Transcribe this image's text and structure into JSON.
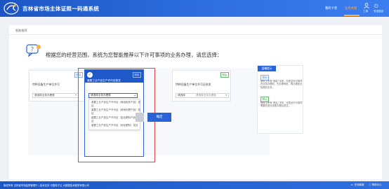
{
  "header": {
    "site_title": "吉林省市场主体证照一码通系统",
    "nav_mine": "我的卡卷",
    "nav_active": "业务办理",
    "user_label": "工商",
    "logout_label": "安全退出"
  },
  "breadcrumb": "智能推荐",
  "question": "根据您的经营范围，系统为您智能推荐以下许可事项的业务办理，请您选择：",
  "cards": [
    {
      "badge": "照后",
      "title": "特种设备生产单位许可",
      "select_value": "请选择业务办理类"
    },
    {
      "badge": "照前",
      "title": "重要工业产品生产许可证核发",
      "select_value": "请选择业务办理类",
      "dropdown": [
        "重要工业产品生产许可证（食品相关产品）发证",
        "重要工业产品生产许可证（其他化肥产品）发证",
        "重要工业产品生产许可证（复合肥料产品）发证",
        "重要工业产品生产许可证（危化肥料）发证"
      ]
    },
    {
      "badge": "照后",
      "title": "特种设备生产单位许可证核发",
      "select_value": "请选择",
      "hint": "请选择业务办理类"
    }
  ],
  "buttons": {
    "confirm": "确定"
  },
  "tips": {
    "head": "温馨提示",
    "badge1": "照前",
    "text1": "提标上所有“照前”字样，代表该许可事项在业务办理前，先办理审批，再办理营业执照的业务。",
    "badge2": "照后",
    "text2": "提标上所有“照后”字样，代表该许可事项需要在营业执照办理后提交。"
  },
  "footer": {
    "text": "版权所有 吉林省市场监督管理厅 | 技术支持 中国电子云 大数据技术服务有限公司",
    "service": "在线客服",
    "help": "帮助中心"
  },
  "colors": {
    "primary": "#2a62d8",
    "header": "#1c56c4",
    "nav_active": "#ffb13a",
    "highlight": "#e04a4a"
  }
}
